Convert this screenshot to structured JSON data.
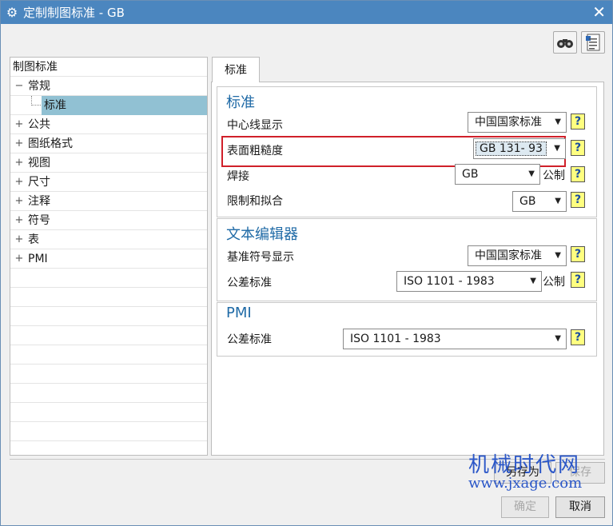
{
  "window": {
    "title": "定制制图标准 - GB",
    "close": "✕"
  },
  "tree": {
    "header": "制图标准",
    "items": [
      {
        "label": "常规",
        "expander": "−"
      },
      {
        "label": "标准"
      },
      {
        "label": "公共",
        "expander": "+"
      },
      {
        "label": "图纸格式",
        "expander": "+"
      },
      {
        "label": "视图",
        "expander": "+"
      },
      {
        "label": "尺寸",
        "expander": "+"
      },
      {
        "label": "注释",
        "expander": "+"
      },
      {
        "label": "符号",
        "expander": "+"
      },
      {
        "label": "表",
        "expander": "+"
      },
      {
        "label": "PMI",
        "expander": "+"
      }
    ]
  },
  "tab": {
    "label": "标准"
  },
  "groups": {
    "standard": {
      "title": "标准",
      "rows": [
        {
          "label": "中心线显示",
          "value": "中国国家标准"
        },
        {
          "label": "表面粗糙度",
          "value": "GB 131- 93"
        },
        {
          "label": "焊接",
          "value": "GB",
          "unit": "公制"
        },
        {
          "label": "限制和拟合",
          "value": "GB"
        }
      ]
    },
    "text_editor": {
      "title": "文本编辑器",
      "rows": [
        {
          "label": "基准符号显示",
          "value": "中国国家标准"
        },
        {
          "label": "公差标准",
          "value": "ISO 1101 - 1983",
          "unit": "公制"
        }
      ]
    },
    "pmi": {
      "title": "PMI",
      "rows": [
        {
          "label": "公差标准",
          "value": "ISO 1101 - 1983"
        }
      ]
    }
  },
  "help_glyph": "?",
  "dropdown_arrow": "▼",
  "buttons": {
    "save_as": "另存为",
    "save": "保存",
    "ok": "确定",
    "cancel": "取消"
  },
  "watermark": {
    "line1": "机械时代网",
    "line2": "www.jxage.com"
  },
  "colors": {
    "titlebar": "#4b86bf",
    "selection": "#91c1d3",
    "group_title": "#1f6aa6",
    "highlight": "#d0202a",
    "help_bg": "#ffff80"
  }
}
